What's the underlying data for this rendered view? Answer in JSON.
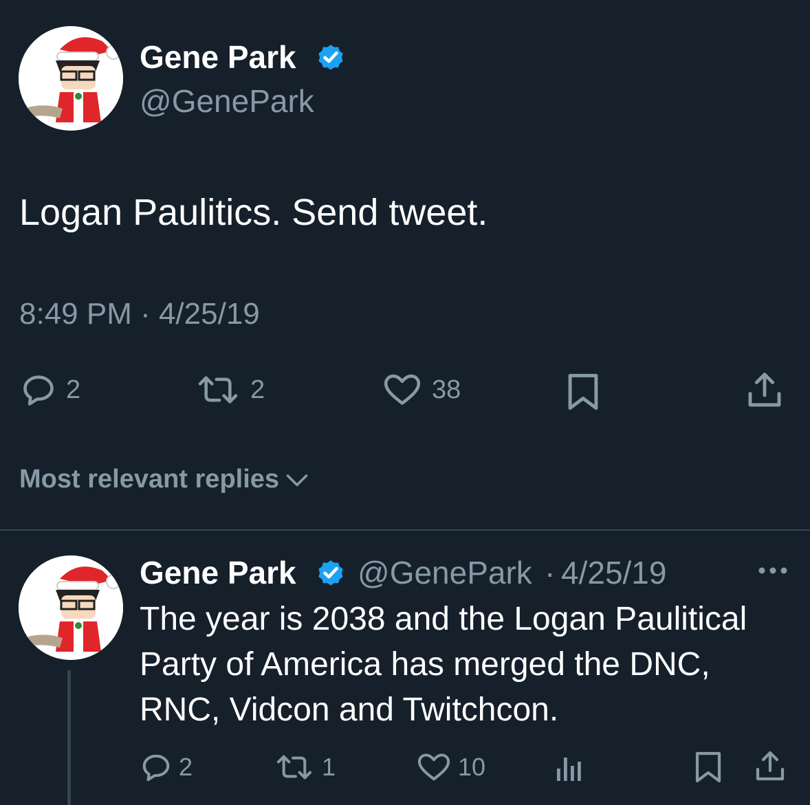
{
  "tweet": {
    "author": {
      "display_name": "Gene Park",
      "handle": "@GenePark",
      "verified": true,
      "avatar_label": "wp"
    },
    "text": "Logan Paulitics. Send tweet.",
    "timestamp": "8:49 PM · 4/25/19",
    "actions": {
      "replies": "2",
      "retweets": "2",
      "likes": "38"
    }
  },
  "replies_sort": {
    "label": "Most relevant replies"
  },
  "reply": {
    "author": {
      "display_name": "Gene Park",
      "handle": "@GenePark",
      "separator": "·",
      "date": "4/25/19",
      "verified": true,
      "avatar_label": "wp"
    },
    "text": "The year is 2038 and the Logan Paulitical Party of America has merged the DNC, RNC, Vidcon and Twitchcon.",
    "actions": {
      "replies": "2",
      "retweets": "1",
      "likes": "10"
    }
  },
  "colors": {
    "background": "#15202b",
    "primary_text": "#ffffff",
    "secondary_text": "#8899a6",
    "verified_blue": "#1da1f2",
    "divider": "#38444d"
  },
  "icons": {
    "reply": "speech-bubble-icon",
    "retweet": "retweet-icon",
    "like": "heart-icon",
    "bookmark": "bookmark-icon",
    "share": "share-icon",
    "analytics": "bar-chart-icon",
    "more": "ellipsis-icon",
    "sort": "chevron-down-icon",
    "verified": "verified-badge-icon"
  }
}
